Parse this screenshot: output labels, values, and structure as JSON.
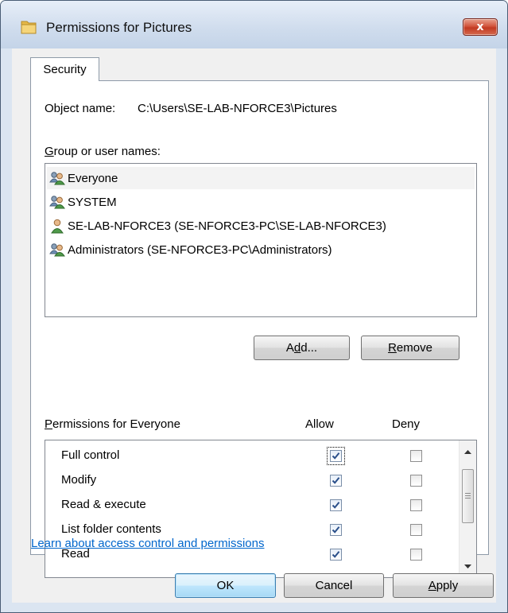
{
  "window": {
    "title": "Permissions for Pictures",
    "close_label": "x",
    "title_icon": "folder-icon"
  },
  "tab": {
    "label": "Security"
  },
  "object": {
    "label": "Object name:",
    "value": "C:\\Users\\SE-LAB-NFORCE3\\Pictures"
  },
  "groups": {
    "label": "Group or user names:",
    "items": [
      {
        "name": "Everyone",
        "icon": "group-icon",
        "selected": true
      },
      {
        "name": "SYSTEM",
        "icon": "group-icon",
        "selected": false
      },
      {
        "name": "SE-LAB-NFORCE3 (SE-NFORCE3-PC\\SE-LAB-NFORCE3)",
        "icon": "user-icon",
        "selected": false
      },
      {
        "name": "Administrators (SE-NFORCE3-PC\\Administrators)",
        "icon": "group-icon",
        "selected": false
      }
    ]
  },
  "buttons": {
    "add": "Add...",
    "remove": "Remove",
    "ok": "OK",
    "cancel": "Cancel",
    "apply": "Apply"
  },
  "permissions": {
    "label": "Permissions for Everyone",
    "allow_header": "Allow",
    "deny_header": "Deny",
    "rows": [
      {
        "name": "Full control",
        "allow": true,
        "deny": false
      },
      {
        "name": "Modify",
        "allow": true,
        "deny": false
      },
      {
        "name": "Read & execute",
        "allow": true,
        "deny": false
      },
      {
        "name": "List folder contents",
        "allow": true,
        "deny": false
      },
      {
        "name": "Read",
        "allow": true,
        "deny": false
      }
    ]
  },
  "link": {
    "text": "Learn about access control and permissions"
  },
  "colors": {
    "link": "#0066cc",
    "close_button": "#c23a22",
    "selection": "#f3f3f3"
  }
}
